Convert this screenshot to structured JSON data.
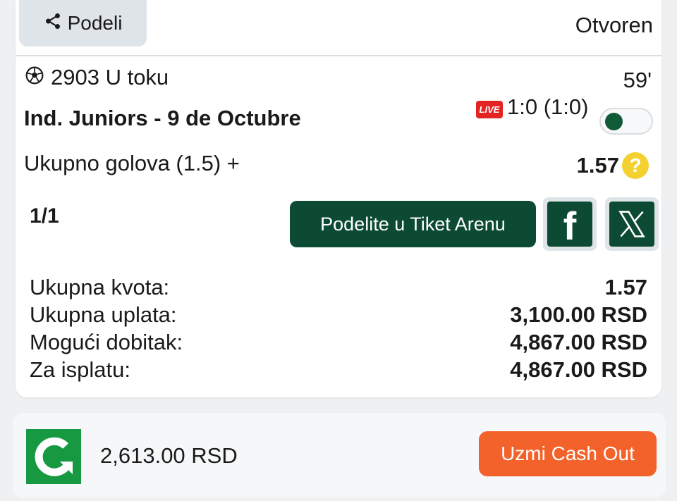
{
  "header": {
    "share_label": "Podeli",
    "status": "Otvoren"
  },
  "event": {
    "code_status": "2903 U toku",
    "minute": "59'",
    "match": "Ind. Juniors - 9 de Octubre",
    "live_badge": "LIVE",
    "score": "1:0 (1:0)",
    "market": "Ukupno golova (1.5) +",
    "odd": "1.57",
    "help": "?"
  },
  "ticket": {
    "count": "1/1",
    "arena_button": "Podelite u Tiket Arenu",
    "facebook_glyph": "f"
  },
  "summary": [
    {
      "label": "Ukupna kvota:",
      "value": "1.57"
    },
    {
      "label": "Ukupna uplata:",
      "value": "3,100.00 RSD"
    },
    {
      "label": "Mogući dobitak:",
      "value": "4,867.00 RSD"
    },
    {
      "label": "Za isplatu:",
      "value": "4,867.00 RSD"
    }
  ],
  "cashout": {
    "amount": "2,613.00 RSD",
    "button": "Uzmi Cash Out"
  },
  "colors": {
    "brand_green": "#0c4a33",
    "cashout_orange": "#f2622a",
    "live_red": "#e42323",
    "help_yellow": "#f4d131"
  }
}
